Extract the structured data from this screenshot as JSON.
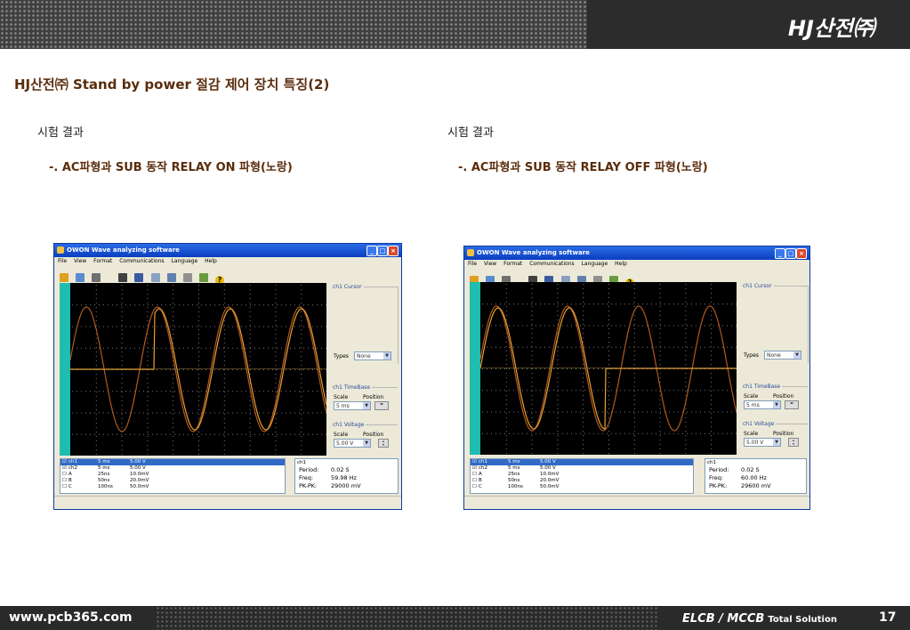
{
  "header": {
    "brand": "HJ산전㈜"
  },
  "page_title": "HJ산전㈜ Stand by power 절감  제어 장치 특징(2)",
  "left": {
    "section_label": "시험 결과",
    "subtitle": "-. AC파형과 SUB 동작 RELAY ON 파형(노랑)",
    "window": {
      "title": "OWON Wave analyzing software",
      "menu": [
        "File",
        "View",
        "Format",
        "Communications",
        "Language",
        "Help"
      ],
      "cursor_head": "ch1 Cursor",
      "types_label": "Types",
      "types_value": "None",
      "timebase_head": "ch1 TimeBase",
      "scale_label": "Scale",
      "position_label": "Position",
      "timebase_scale": "5   ms",
      "voltage_head": "ch1 Voltage",
      "voltage_scale": "5.00 V",
      "channels": [
        {
          "name": "ch1",
          "time": "5    ms",
          "volt": "5.00 V"
        },
        {
          "name": "ch2",
          "time": "5    ms",
          "volt": "5.00 V"
        },
        {
          "name": "A",
          "time": "25ns",
          "volt": "10.0mV"
        },
        {
          "name": "B",
          "time": "50ns",
          "volt": "20.0mV"
        },
        {
          "name": "C",
          "time": "100ns",
          "volt": "50.0mV"
        }
      ],
      "info_head": "ch1",
      "period_label": "Period:",
      "period": "0.02 S",
      "freq_label": "Freq:",
      "freq": "59.98 Hz",
      "pkpk_label": "PK-PK:",
      "pkpk": "29000 mV"
    }
  },
  "right": {
    "section_label": "시험 결과",
    "subtitle": "-. AC파형과 SUB 동작 RELAY OFF 파형(노랑)",
    "window": {
      "title": "OWON Wave analyzing software",
      "menu": [
        "File",
        "View",
        "Format",
        "Communications",
        "Language",
        "Help"
      ],
      "cursor_head": "ch1 Cursor",
      "types_label": "Types",
      "types_value": "None",
      "timebase_head": "ch1 TimeBase",
      "scale_label": "Scale",
      "position_label": "Position",
      "timebase_scale": "5   ms",
      "voltage_head": "ch1 Voltage",
      "voltage_scale": "5.00 V",
      "channels": [
        {
          "name": "ch1",
          "time": "5    ms",
          "volt": "5.00 V"
        },
        {
          "name": "ch2",
          "time": "5    ms",
          "volt": "5.00 V"
        },
        {
          "name": "A",
          "time": "25ns",
          "volt": "10.0mV"
        },
        {
          "name": "B",
          "time": "50ns",
          "volt": "20.0mV"
        },
        {
          "name": "C",
          "time": "100ns",
          "volt": "50.0mV"
        }
      ],
      "info_head": "ch1",
      "period_label": "Period:",
      "period": "0.02 S",
      "freq_label": "Freq:",
      "freq": "60.00 Hz",
      "pkpk_label": "PK-PK:",
      "pkpk": "29600 mV"
    }
  },
  "footer": {
    "site": "www.pcb365.com",
    "product": "ELCB / MCCB",
    "product_suffix": "Total Solution",
    "page_number": "17"
  },
  "colors": {
    "title_brown": "#5a2d0c",
    "trace_ch1": "#e8a030",
    "trace_ch2": "#b05a20",
    "screen": "#000000",
    "window_blue": "#0a3fbf"
  }
}
